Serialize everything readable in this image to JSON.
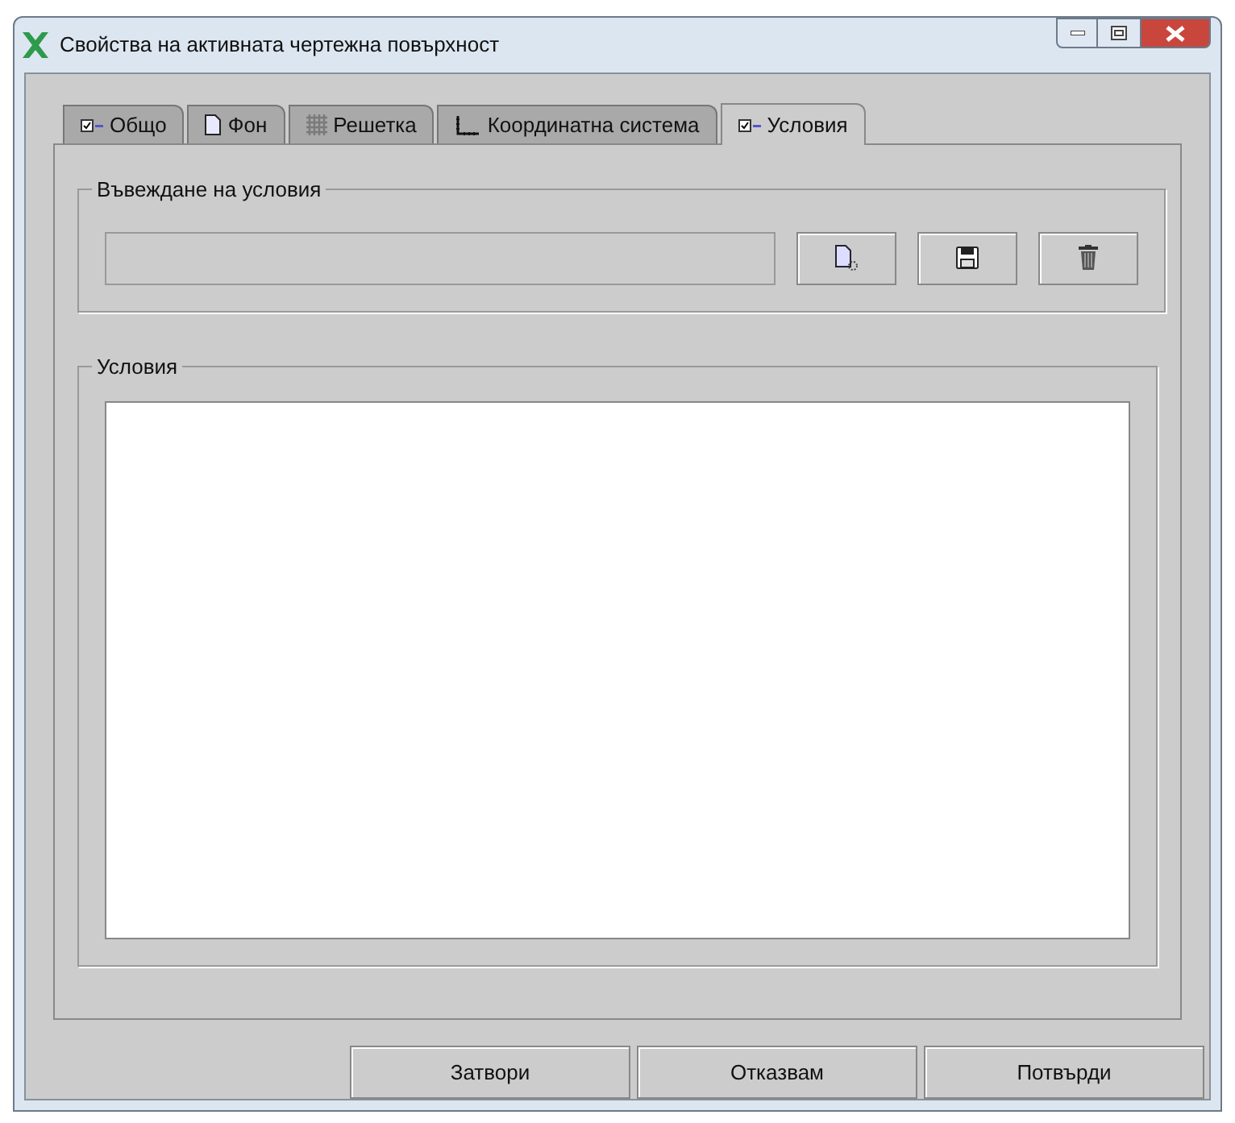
{
  "window": {
    "title": "Свойства на активната чертежна повърхност"
  },
  "tabs": [
    {
      "label": "Общо",
      "kind": "check",
      "selected": false
    },
    {
      "label": "Фон",
      "kind": "page",
      "selected": false
    },
    {
      "label": "Решетка",
      "kind": "grid",
      "selected": false
    },
    {
      "label": "Координатна система",
      "kind": "axes",
      "selected": false
    },
    {
      "label": "Условия",
      "kind": "check",
      "selected": true
    }
  ],
  "entry_group": {
    "title": "Въвеждане на условия",
    "tools": [
      {
        "kind": "new"
      },
      {
        "kind": "save"
      },
      {
        "kind": "delete"
      }
    ]
  },
  "conditions_group": {
    "title": "Условия"
  },
  "buttons": [
    "Затвори",
    "Отказвам",
    "Потвърди"
  ]
}
